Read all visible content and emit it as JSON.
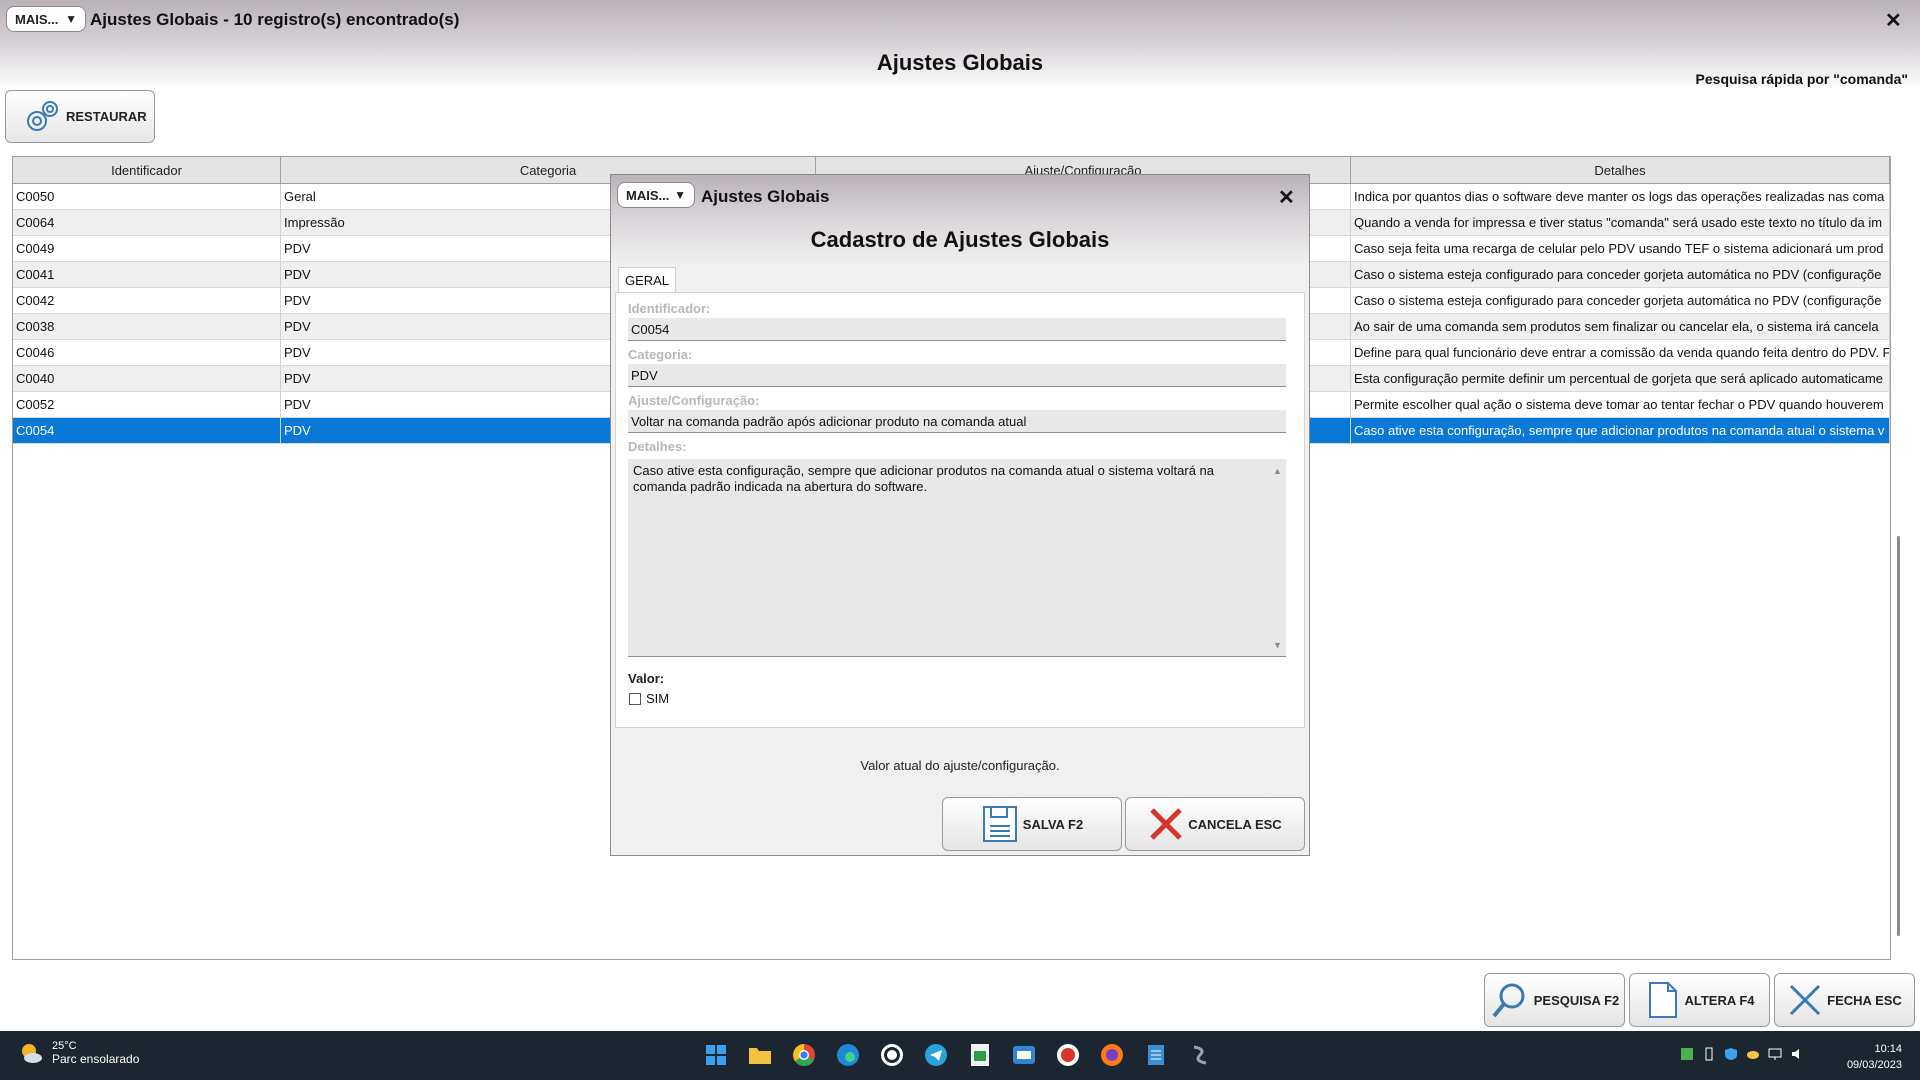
{
  "window": {
    "mais_label": "MAIS...",
    "title": "Ajustes Globais - 10 registro(s) encontrado(s)",
    "heading": "Ajustes Globais",
    "close_glyph": "✕",
    "quick_search": "Pesquisa rápida por \"comanda\""
  },
  "toolbar": {
    "restore_label": "RESTAURAR",
    "restore_icon": "gears-icon"
  },
  "grid": {
    "columns": [
      "Identificador",
      "Categoria",
      "Ajuste/Configuração",
      "Detalhes"
    ],
    "rows": [
      {
        "id": "C0050",
        "category": "Geral",
        "setting": "",
        "details": "Indica por quantos dias o software deve manter os logs das operações realizadas nas coma"
      },
      {
        "id": "C0064",
        "category": "Impressão",
        "setting": "",
        "details": "Quando a venda for impressa e tiver status \"comanda\" será usado este texto no título da im"
      },
      {
        "id": "C0049",
        "category": "PDV",
        "setting": "",
        "details": "Caso seja feita uma recarga de celular pelo PDV usando TEF o sistema adicionará um prod"
      },
      {
        "id": "C0041",
        "category": "PDV",
        "setting": "",
        "details": "Caso o sistema esteja configurado para conceder gorjeta automática no PDV (configuraçõe"
      },
      {
        "id": "C0042",
        "category": "PDV",
        "setting": "",
        "details": "Caso o sistema esteja configurado para conceder gorjeta automática no PDV (configuraçõe"
      },
      {
        "id": "C0038",
        "category": "PDV",
        "setting": "",
        "details": "Ao sair de uma comanda sem produtos sem finalizar ou cancelar ela, o sistema irá cancela"
      },
      {
        "id": "C0046",
        "category": "PDV",
        "setting": "",
        "details": "Define para qual funcionário deve entrar a comissão da venda quando feita dentro do PDV. F"
      },
      {
        "id": "C0040",
        "category": "PDV",
        "setting": "",
        "details": "Esta configuração permite definir um percentual de gorjeta que será aplicado automaticame"
      },
      {
        "id": "C0052",
        "category": "PDV",
        "setting": "",
        "details": "Permite escolher qual ação o sistema deve tomar ao tentar fechar o PDV quando houverem"
      },
      {
        "id": "C0054",
        "category": "PDV",
        "setting": "",
        "details": "Caso ative esta configuração, sempre que adicionar produtos na comanda atual o sistema v"
      }
    ]
  },
  "bottom_buttons": {
    "search": "PESQUISA F2",
    "edit": "ALTERA F4",
    "close": "FECHA ESC"
  },
  "dialog": {
    "mais_label": "MAIS...",
    "title": "Ajustes Globais",
    "heading": "Cadastro de Ajustes Globais",
    "close_glyph": "✕",
    "tab": "GERAL",
    "fields": {
      "id_label": "Identificador:",
      "id_value": "C0054",
      "category_label": "Categoria:",
      "category_value": "PDV",
      "setting_label": "Ajuste/Configuração:",
      "setting_value": "Voltar na comanda padrão após adicionar produto na comanda atual",
      "details_label": "Detalhes:",
      "details_value": "Caso ative esta configuração, sempre que adicionar produtos na comanda atual o sistema voltará na comanda padrão indicada na abertura do software.",
      "valor_label": "Valor:",
      "sim_label": "SIM",
      "sim_checked": false
    },
    "hint": "Valor atual do ajuste/configuração.",
    "save_label": "SALVA F2",
    "cancel_label": "CANCELA ESC"
  },
  "taskbar": {
    "temperature": "25°C",
    "weather": "Parc ensolarado",
    "time": "10:14",
    "date": "09/03/2023",
    "apps": [
      "windows-start-icon",
      "file-explorer-icon",
      "chrome-icon",
      "edge-icon",
      "whatsapp-icon",
      "telegram-icon",
      "spreadsheet-icon",
      "outlook-icon",
      "app-icon",
      "firefox-icon",
      "notepad-icon",
      "system-app-icon"
    ]
  },
  "colors": {
    "selection": "#0a78d7",
    "taskbar": "#1c2630",
    "title_gradient_top": "#b9b2b9"
  }
}
